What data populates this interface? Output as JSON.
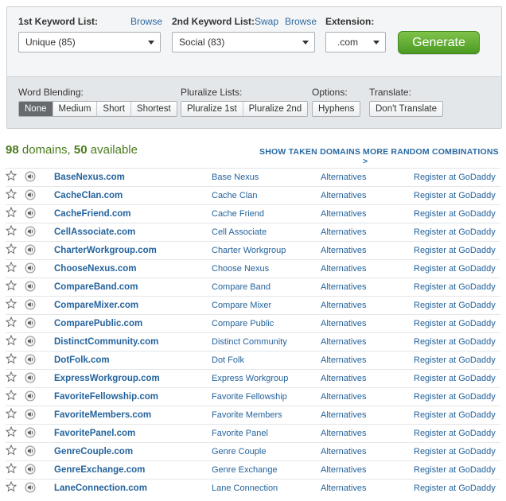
{
  "form": {
    "list1_label": "1st Keyword List:",
    "list1_browse": "Browse",
    "list1_value": "Unique (85)",
    "list2_label": "2nd Keyword List:",
    "list2_swap": "Swap",
    "list2_browse": "Browse",
    "list2_value": "Social (83)",
    "ext_label": "Extension:",
    "ext_value": ".com",
    "generate": "Generate"
  },
  "options": {
    "blending_label": "Word Blending:",
    "blending": [
      "None",
      "Medium",
      "Short",
      "Shortest"
    ],
    "blending_selected": "None",
    "pluralize_label": "Pluralize Lists:",
    "pluralize": [
      "Pluralize 1st",
      "Pluralize 2nd"
    ],
    "options_label": "Options:",
    "hyphens": "Hyphens",
    "translate_label": "Translate:",
    "translate": "Don't Translate"
  },
  "summary": {
    "total": "98",
    "total_text": "domains,",
    "available": "50",
    "available_text": "available",
    "show_taken": "SHOW TAKEN DOMAINS",
    "more_random": "MORE RANDOM COMBINATIONS >"
  },
  "colors": {
    "accent": "#24639c",
    "generate_green": "#5aa62b",
    "summary_green": "#4a7a1c"
  },
  "icons": {
    "favorite": "star-outline-icon",
    "pronounce": "speaker-icon"
  },
  "results": [
    {
      "domain": "BaseNexus.com",
      "words": "Base Nexus",
      "alt": "Alternatives",
      "register": "Register at GoDaddy"
    },
    {
      "domain": "CacheClan.com",
      "words": "Cache Clan",
      "alt": "Alternatives",
      "register": "Register at GoDaddy"
    },
    {
      "domain": "CacheFriend.com",
      "words": "Cache Friend",
      "alt": "Alternatives",
      "register": "Register at GoDaddy"
    },
    {
      "domain": "CellAssociate.com",
      "words": "Cell Associate",
      "alt": "Alternatives",
      "register": "Register at GoDaddy"
    },
    {
      "domain": "CharterWorkgroup.com",
      "words": "Charter Workgroup",
      "alt": "Alternatives",
      "register": "Register at GoDaddy"
    },
    {
      "domain": "ChooseNexus.com",
      "words": "Choose Nexus",
      "alt": "Alternatives",
      "register": "Register at GoDaddy"
    },
    {
      "domain": "CompareBand.com",
      "words": "Compare Band",
      "alt": "Alternatives",
      "register": "Register at GoDaddy"
    },
    {
      "domain": "CompareMixer.com",
      "words": "Compare Mixer",
      "alt": "Alternatives",
      "register": "Register at GoDaddy"
    },
    {
      "domain": "ComparePublic.com",
      "words": "Compare Public",
      "alt": "Alternatives",
      "register": "Register at GoDaddy"
    },
    {
      "domain": "DistinctCommunity.com",
      "words": "Distinct Community",
      "alt": "Alternatives",
      "register": "Register at GoDaddy"
    },
    {
      "domain": "DotFolk.com",
      "words": "Dot Folk",
      "alt": "Alternatives",
      "register": "Register at GoDaddy"
    },
    {
      "domain": "ExpressWorkgroup.com",
      "words": "Express Workgroup",
      "alt": "Alternatives",
      "register": "Register at GoDaddy"
    },
    {
      "domain": "FavoriteFellowship.com",
      "words": "Favorite Fellowship",
      "alt": "Alternatives",
      "register": "Register at GoDaddy"
    },
    {
      "domain": "FavoriteMembers.com",
      "words": "Favorite Members",
      "alt": "Alternatives",
      "register": "Register at GoDaddy"
    },
    {
      "domain": "FavoritePanel.com",
      "words": "Favorite Panel",
      "alt": "Alternatives",
      "register": "Register at GoDaddy"
    },
    {
      "domain": "GenreCouple.com",
      "words": "Genre Couple",
      "alt": "Alternatives",
      "register": "Register at GoDaddy"
    },
    {
      "domain": "GenreExchange.com",
      "words": "Genre Exchange",
      "alt": "Alternatives",
      "register": "Register at GoDaddy"
    },
    {
      "domain": "LaneConnection.com",
      "words": "Lane Connection",
      "alt": "Alternatives",
      "register": "Register at GoDaddy"
    }
  ]
}
